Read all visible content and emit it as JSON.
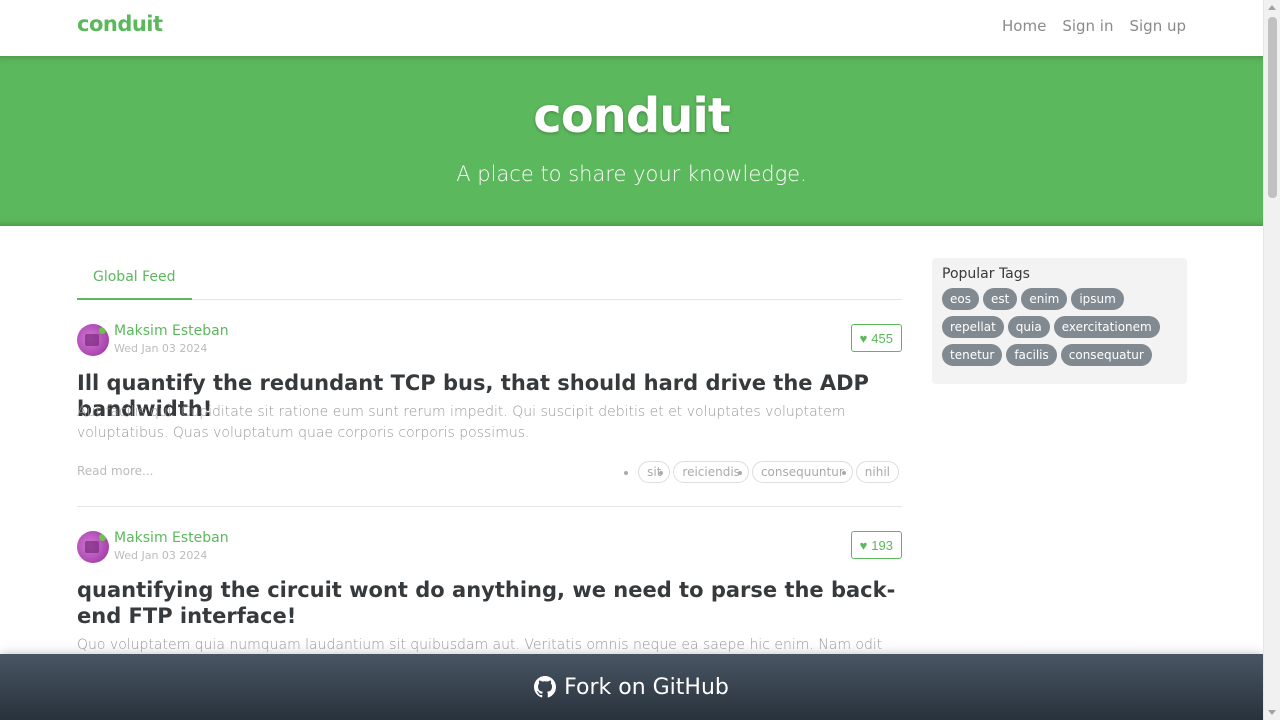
{
  "nav": {
    "brand": "conduit",
    "links": [
      "Home",
      "Sign in",
      "Sign up"
    ]
  },
  "banner": {
    "title": "conduit",
    "subtitle": "A place to share your knowledge."
  },
  "feed": {
    "active_tab": "Global Feed"
  },
  "articles": [
    {
      "author": "Maksim Esteban",
      "date": "Wed Jan 03 2024",
      "likes": "455",
      "title": "Ill quantify the redundant TCP bus, that should hard drive the ADP bandwidth!",
      "description": "Aut facilis qui. Cupiditate sit ratione eum sunt rerum impedit. Qui suscipit debitis et et voluptates voluptatem voluptatibus. Quas voluptatum quae corporis corporis possimus.",
      "read_more": "Read more...",
      "tags": [
        "sit",
        "reiciendis",
        "consequuntur",
        "nihil"
      ]
    },
    {
      "author": "Maksim Esteban",
      "date": "Wed Jan 03 2024",
      "likes": "193",
      "title": "quantifying the circuit wont do anything, we need to parse the back-end FTP interface!",
      "description": "Quo voluptatem quia numquam laudantium sit quibusdam aut. Veritatis omnis neque ea saepe hic enim. Nam odit dolor non"
    }
  ],
  "sidebar": {
    "title": "Popular Tags",
    "tags": [
      "eos",
      "est",
      "enim",
      "ipsum",
      "repellat",
      "quia",
      "exercitationem",
      "tenetur",
      "facilis",
      "consequatur"
    ]
  },
  "footer": {
    "label": "Fork on GitHub",
    "icon": "github-icon"
  },
  "colors": {
    "brand": "#5cb85c",
    "tag_pill": "#818a91",
    "footer_top": "#485563",
    "footer_bottom": "#29323c"
  }
}
